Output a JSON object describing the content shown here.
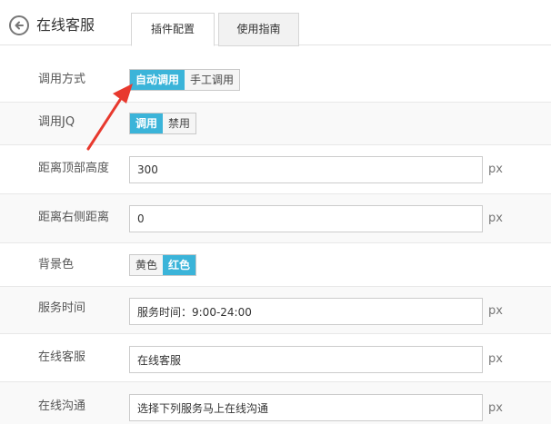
{
  "header": {
    "title": "在线客服",
    "tabs": [
      {
        "label": "插件配置",
        "active": true
      },
      {
        "label": "使用指南",
        "active": false
      }
    ]
  },
  "form": {
    "call_method": {
      "label": "调用方式",
      "options": [
        "自动调用",
        "手工调用"
      ],
      "selected": "自动调用"
    },
    "jq": {
      "label": "调用JQ",
      "options": [
        "调用",
        "禁用"
      ],
      "selected": "调用"
    },
    "top_distance": {
      "label": "距离顶部高度",
      "value": "300",
      "unit": "px"
    },
    "right_distance": {
      "label": "距离右侧距离",
      "value": "0",
      "unit": "px"
    },
    "bg_color": {
      "label": "背景色",
      "options": [
        "黄色",
        "红色"
      ],
      "selected": "红色"
    },
    "service_time": {
      "label": "服务时间",
      "value": "服务时间：9:00-24:00",
      "unit": "px"
    },
    "online_service": {
      "label": "在线客服",
      "value": "在线客服",
      "unit": "px"
    },
    "online_chat": {
      "label": "在线沟通",
      "value": "选择下列服务马上在线沟通",
      "unit": "px"
    }
  },
  "colors": {
    "accent": "#3bb4d9",
    "annotation_arrow": "#e8392e"
  }
}
